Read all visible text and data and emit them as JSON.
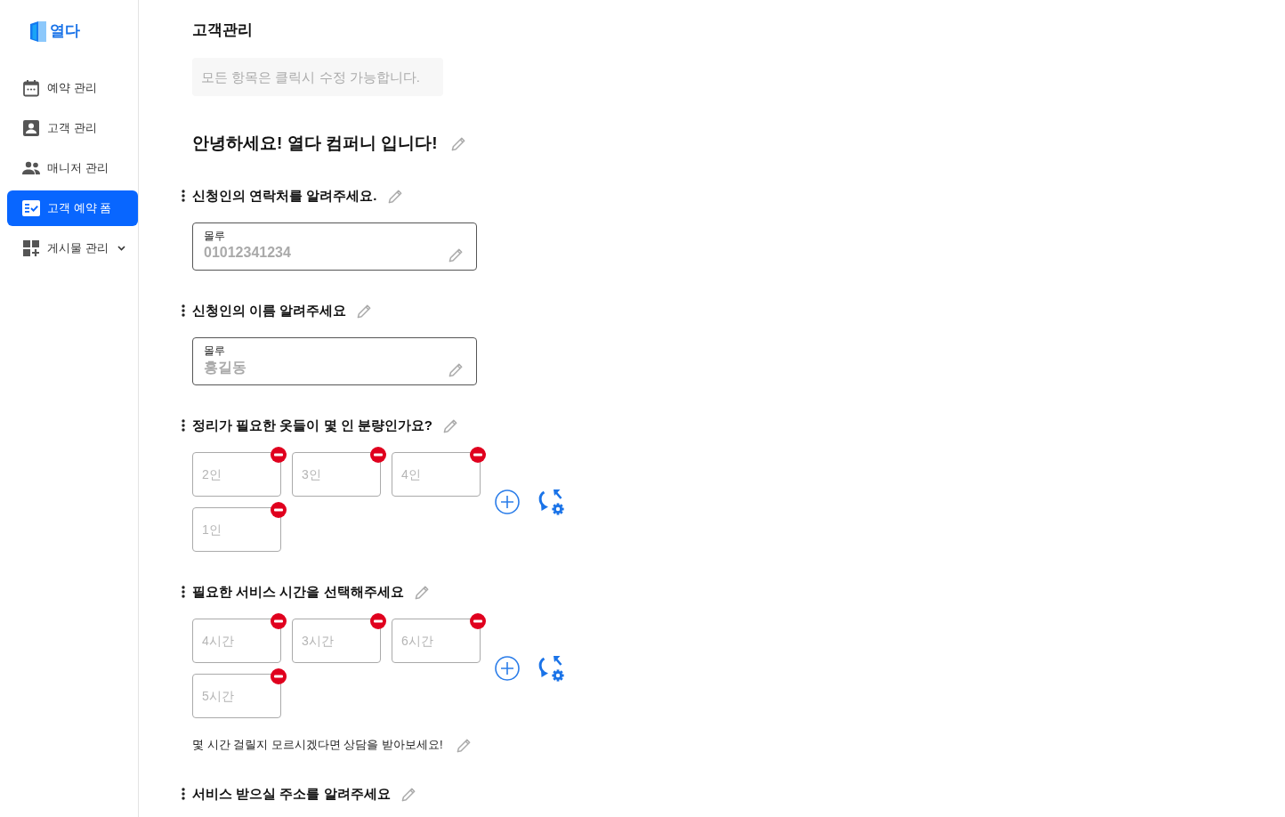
{
  "sidebar": {
    "logo": "열다",
    "items": [
      {
        "label": "예약 관리",
        "selected": false
      },
      {
        "label": "고객 관리",
        "selected": false
      },
      {
        "label": "매니저 관리",
        "selected": false
      },
      {
        "label": "고객 예약 폼",
        "selected": true
      },
      {
        "label": "게시물 관리",
        "selected": false,
        "expanded": false
      }
    ]
  },
  "page": {
    "title": "고객관리",
    "notice": "모든 항목은 클릭시 수정 가능합니다."
  },
  "form": {
    "greeting": "안녕하세요! 열다 컴퍼니 입니다!",
    "questions": [
      {
        "kind": "text",
        "label": "신청인의 연락처를 알려주세요.",
        "field": {
          "label": "몰루",
          "placeholder": "01012341234"
        }
      },
      {
        "kind": "text",
        "label": "신청인의 이름 알려주세요",
        "field": {
          "label": "몰루",
          "placeholder": "홍길동"
        }
      },
      {
        "kind": "choice",
        "label": "정리가 필요한 옷들이 몇 인 분량인가요?",
        "options": [
          {
            "placeholder": "2인"
          },
          {
            "placeholder": "3인"
          },
          {
            "placeholder": "4인"
          },
          {
            "placeholder": "1인"
          }
        ]
      },
      {
        "kind": "choice",
        "label": "필요한 서비스 시간을 선택해주세요",
        "options": [
          {
            "placeholder": "4시간"
          },
          {
            "placeholder": "3시간"
          },
          {
            "placeholder": "6시간"
          },
          {
            "placeholder": "5시간"
          }
        ],
        "note": "몇 시간 걸릴지 모르시겠다면 상담을 받아보세요!"
      },
      {
        "kind": "text",
        "label": "서비스 받으실 주소를 알려주세요"
      }
    ]
  }
}
